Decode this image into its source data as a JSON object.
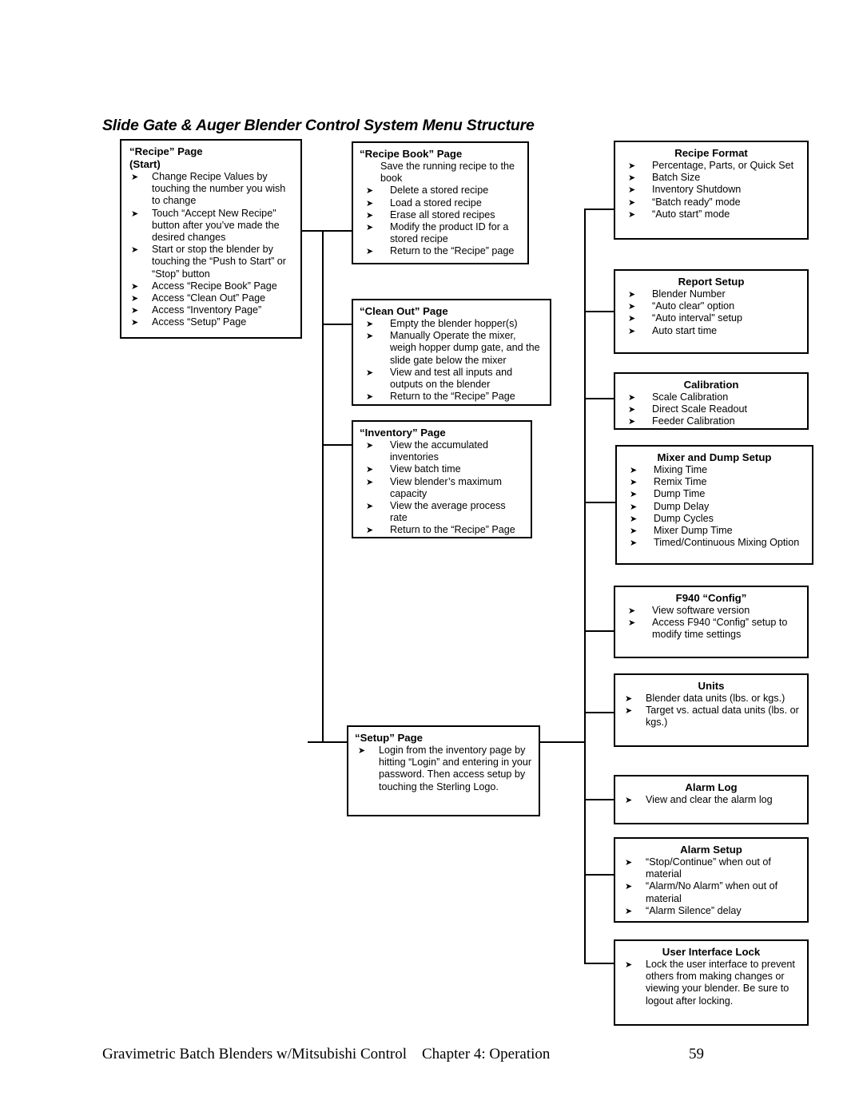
{
  "title": "Slide Gate & Auger Blender Control System Menu Structure",
  "bullet_glyph": "➤",
  "boxes": {
    "recipe": {
      "title": "“Recipe” Page\n      (Start)",
      "items": [
        "Change Recipe Values by touching the number you wish to change",
        "Touch “Accept New Recipe\" button after you’ve made the desired changes",
        "Start or stop the blender by touching the “Push to Start” or “Stop” button",
        "Access “Recipe Book” Page",
        "Access “Clean Out” Page",
        "Access “Inventory Page”",
        "Access “Setup” Page"
      ]
    },
    "recipe_book": {
      "title": "“Recipe Book” Page",
      "lead": "Save the running recipe to the book",
      "items": [
        "Delete a stored recipe",
        "Load a stored recipe",
        "Erase all stored recipes",
        "Modify the product ID for a stored recipe",
        "Return to the “Recipe” page"
      ]
    },
    "clean_out": {
      "title": "“Clean Out” Page",
      "items": [
        "Empty the blender hopper(s)",
        "Manually Operate the mixer, weigh hopper dump gate, and the slide gate below the mixer",
        "View and test all inputs and outputs on the blender",
        "Return to the “Recipe” Page"
      ]
    },
    "inventory": {
      "title": "“Inventory” Page",
      "items": [
        "View the accumulated inventories",
        "View batch time",
        "View blender’s maximum capacity",
        "View the average process rate",
        "Return to the “Recipe” Page"
      ]
    },
    "setup": {
      "title": "“Setup” Page",
      "items": [
        "Login from the inventory page by hitting “Login” and entering in your password.  Then access setup by touching the Sterling Logo."
      ]
    },
    "recipe_format": {
      "title": "Recipe Format",
      "items": [
        "Percentage, Parts, or Quick Set",
        "Batch Size",
        "Inventory Shutdown",
        "“Batch ready” mode",
        "“Auto start” mode"
      ]
    },
    "report_setup": {
      "title": "Report Setup",
      "items": [
        "Blender Number",
        "“Auto clear\" option",
        "“Auto interval\" setup",
        "Auto start time"
      ]
    },
    "calibration": {
      "title": "Calibration",
      "items": [
        "Scale Calibration",
        "Direct Scale Readout",
        "Feeder Calibration"
      ]
    },
    "mixer_dump": {
      "title": "Mixer and Dump Setup",
      "items": [
        "Mixing Time",
        "Remix Time",
        "Dump Time",
        "Dump Delay",
        "Dump Cycles",
        "Mixer Dump Time",
        "Timed/Continuous Mixing Option"
      ]
    },
    "f940_config": {
      "title": "F940 “Config”",
      "items": [
        "View software version",
        "Access F940 “Config” setup to modify time settings"
      ]
    },
    "units": {
      "title": "Units",
      "items": [
        " Blender data units (lbs. or kgs.)",
        " Target vs. actual data units (lbs. or kgs.)"
      ]
    },
    "alarm_log": {
      "title": "Alarm Log",
      "items": [
        "View and clear the alarm log"
      ]
    },
    "alarm_setup": {
      "title": "Alarm Setup",
      "items": [
        "“Stop/Continue” when out of material",
        "“Alarm/No Alarm” when out of material",
        "“Alarm Silence” delay"
      ]
    },
    "ui_lock": {
      "title": "User Interface Lock",
      "items": [
        " Lock the user interface to prevent others from making changes or viewing your blender.  Be sure to logout after locking."
      ]
    }
  },
  "footer": {
    "left": "Gravimetric Batch Blenders w/Mitsubishi Control    Chapter 4: Operation",
    "page_number": "59"
  }
}
